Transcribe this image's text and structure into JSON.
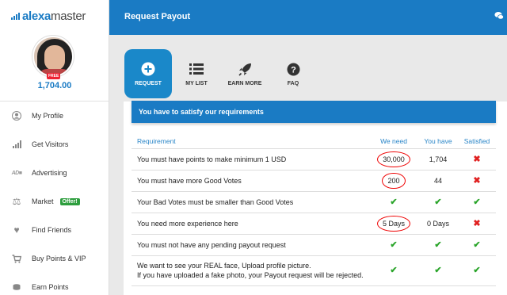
{
  "brand": {
    "name_bold": "alexa",
    "name_light": "master"
  },
  "profile": {
    "badge": "FREE",
    "balance": "1,704.00"
  },
  "sidebar": {
    "items": [
      {
        "label": "My Profile",
        "icon": "user-icon"
      },
      {
        "label": "Get Visitors",
        "icon": "signal-bars-icon"
      },
      {
        "label": "Advertising",
        "icon": "ad-icon"
      },
      {
        "label": "Market",
        "icon": "scale-icon",
        "badge": "Offer!"
      },
      {
        "label": "Find Friends",
        "icon": "heart-icon"
      },
      {
        "label": "Buy Points & VIP",
        "icon": "cart-icon"
      },
      {
        "label": "Earn Points",
        "icon": "coins-icon"
      }
    ]
  },
  "header": {
    "title": "Request Payout",
    "icon": "chat-icon"
  },
  "tabs": [
    {
      "label": "REQUEST",
      "icon": "plus-circle-icon",
      "active": true
    },
    {
      "label": "MY LIST",
      "icon": "list-icon",
      "active": false
    },
    {
      "label": "EARN MORE",
      "icon": "rocket-icon",
      "active": false
    },
    {
      "label": "FAQ",
      "icon": "question-icon",
      "active": false
    }
  ],
  "banner": "You have to satisfy our requirements",
  "table": {
    "headers": {
      "requirement": "Requirement",
      "need": "We need",
      "have": "You have",
      "satisfied": "Satisfied"
    },
    "rows": [
      {
        "requirement": "You must have points to make minimum 1 USD",
        "need": "30,000",
        "have": "1,704",
        "satisfied": false,
        "need_circled": true
      },
      {
        "requirement": "You must have more Good Votes",
        "need": "200",
        "have": "44",
        "satisfied": false,
        "need_circled": true
      },
      {
        "requirement": "Your Bad Votes must be smaller than Good Votes",
        "need": "check",
        "have": "check",
        "satisfied": true
      },
      {
        "requirement": "You need more experience here",
        "need": "5 Days",
        "have": "0 Days",
        "satisfied": false,
        "need_circled": true
      },
      {
        "requirement": "You must not have any pending payout request",
        "need": "check",
        "have": "check",
        "satisfied": true
      },
      {
        "requirement_line1": "We want to see your REAL face, Upload profile picture.",
        "requirement_line2": "If you have uploaded a fake photo, your Payout request will be rejected.",
        "need": "check",
        "have": "check",
        "satisfied": true
      }
    ]
  },
  "colors": {
    "brand_blue": "#1a7bc4",
    "ok_green": "#2ba52b",
    "fail_red": "#e02020",
    "annotation_red": "#ee0000"
  }
}
